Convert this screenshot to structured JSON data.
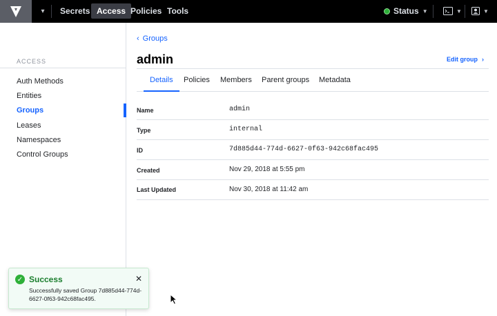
{
  "topnav": {
    "items": [
      {
        "label": "Secrets",
        "active": false
      },
      {
        "label": "Access",
        "active": true
      },
      {
        "label": "Policies",
        "active": false
      },
      {
        "label": "Tools",
        "active": false
      }
    ],
    "status_label": "Status",
    "status_color": "#2eb039",
    "icons": [
      "vault-logo-icon",
      "terminal-icon",
      "user-icon"
    ]
  },
  "sidebar": {
    "title": "ACCESS",
    "items": [
      {
        "label": "Auth Methods",
        "active": false
      },
      {
        "label": "Entities",
        "active": false
      },
      {
        "label": "Groups",
        "active": true
      },
      {
        "label": "Leases",
        "active": false
      },
      {
        "label": "Namespaces",
        "active": false
      },
      {
        "label": "Control Groups",
        "active": false
      }
    ]
  },
  "main": {
    "breadcrumb": "Groups",
    "title": "admin",
    "edit_label": "Edit group",
    "tabs": [
      {
        "label": "Details",
        "active": true
      },
      {
        "label": "Policies",
        "active": false
      },
      {
        "label": "Members",
        "active": false
      },
      {
        "label": "Parent groups",
        "active": false
      },
      {
        "label": "Metadata",
        "active": false
      }
    ],
    "rows": [
      {
        "label": "Name",
        "value": "admin"
      },
      {
        "label": "Type",
        "value": "internal"
      },
      {
        "label": "ID",
        "value": "7d885d44-774d-6627-0f63-942c68fac495"
      },
      {
        "label": "Created",
        "value": "Nov 29, 2018 at 5:55 pm"
      },
      {
        "label": "Last Updated",
        "value": "Nov 30, 2018 at 11:42 am"
      }
    ]
  },
  "toast": {
    "title": "Success",
    "message": "Successfully saved Group 7d885d44-774d-6627-0f63-942c68fac495."
  },
  "colors": {
    "accent": "#1563ff",
    "success": "#2eb039"
  }
}
